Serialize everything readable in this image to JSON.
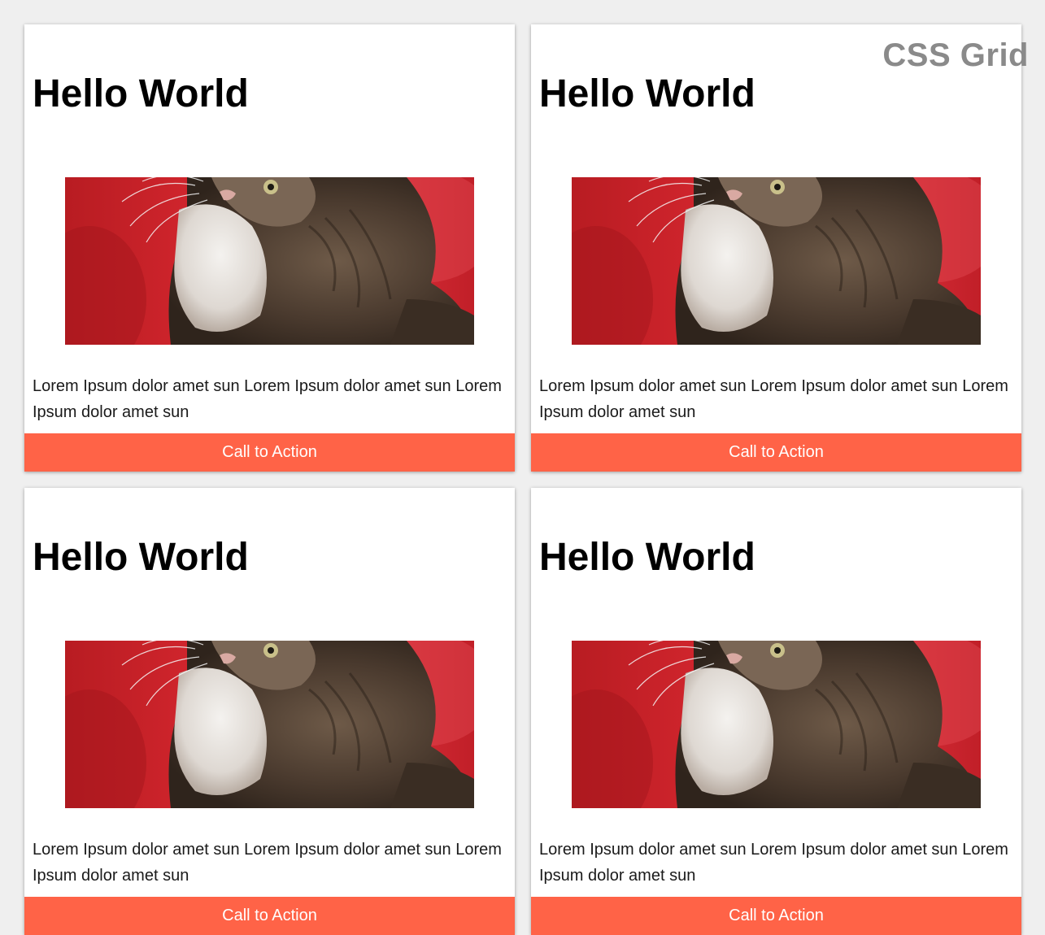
{
  "watermark": "CSS Grid",
  "colors": {
    "page_background": "#efefef",
    "card_background": "#ffffff",
    "cta_background": "#ff6347",
    "cta_text": "#ffffff",
    "watermark": "#8a8a8a"
  },
  "cards": [
    {
      "title": "Hello World",
      "image": "kitten-photo",
      "body": "Lorem Ipsum dolor amet sun Lorem Ipsum dolor amet sun Lorem Ipsum dolor amet sun",
      "cta_label": "Call to Action"
    },
    {
      "title": "Hello World",
      "image": "kitten-photo",
      "body": "Lorem Ipsum dolor amet sun Lorem Ipsum dolor amet sun Lorem Ipsum dolor amet sun",
      "cta_label": "Call to Action"
    },
    {
      "title": "Hello World",
      "image": "kitten-photo",
      "body": "Lorem Ipsum dolor amet sun Lorem Ipsum dolor amet sun Lorem Ipsum dolor amet sun",
      "cta_label": "Call to Action"
    },
    {
      "title": "Hello World",
      "image": "kitten-photo",
      "body": "Lorem Ipsum dolor amet sun Lorem Ipsum dolor amet sun Lorem Ipsum dolor amet sun",
      "cta_label": "Call to Action"
    }
  ]
}
